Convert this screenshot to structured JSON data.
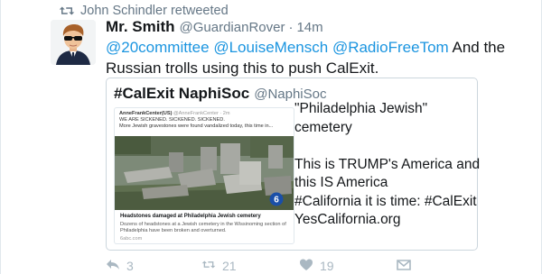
{
  "context": {
    "retweeted_label": "John Schindler retweeted",
    "icon": "retweet-icon"
  },
  "tweet": {
    "author_name": "Mr. Smith",
    "author_handle": "@GuardianRover",
    "separator": "·",
    "timestamp": "14m",
    "mentions": [
      "@20committee",
      "@LouiseMensch",
      "@RadioFreeTom"
    ],
    "text_line1_rest": "And the",
    "text_line2": "Russian trolls using this to push CalExit."
  },
  "quote": {
    "name": "#CalExit NaphiSoc",
    "handle": "@NaphiSoc",
    "lines": [
      "\"Philadelphia Jewish\"",
      "cemetery",
      "",
      "This is TRUMP's America and",
      "this IS America",
      "#California it is time: #CalExit",
      "YesCalifornia.org"
    ]
  },
  "embed": {
    "account_name": "AnneFrankCenter(US)",
    "account_handle": "@AnneFrankCenter · 2m",
    "line1": "WE ARE SICKENED. SICKENED. SICKENED.",
    "line2": "More Jewish gravestones were found vandalized today, this time in...",
    "channel_badge": "6abc",
    "caption_title": "Headstones damaged at Philadelphia Jewish cemetery",
    "caption_desc": "Dozens of headstones at a Jewish cemetery in the Wissinoming section of Philadelphia have been broken and overturned.",
    "caption_site": "6abc.com"
  },
  "actions": {
    "reply_count": "3",
    "retweet_count": "21",
    "like_count": "19",
    "icons": [
      "reply-icon",
      "retweet-icon",
      "like-icon",
      "direct-message-icon"
    ]
  },
  "colors": {
    "link": "#1b95e0",
    "muted": "#657786",
    "action_gray": "#aab8c2",
    "border": "#ccd6dd"
  }
}
